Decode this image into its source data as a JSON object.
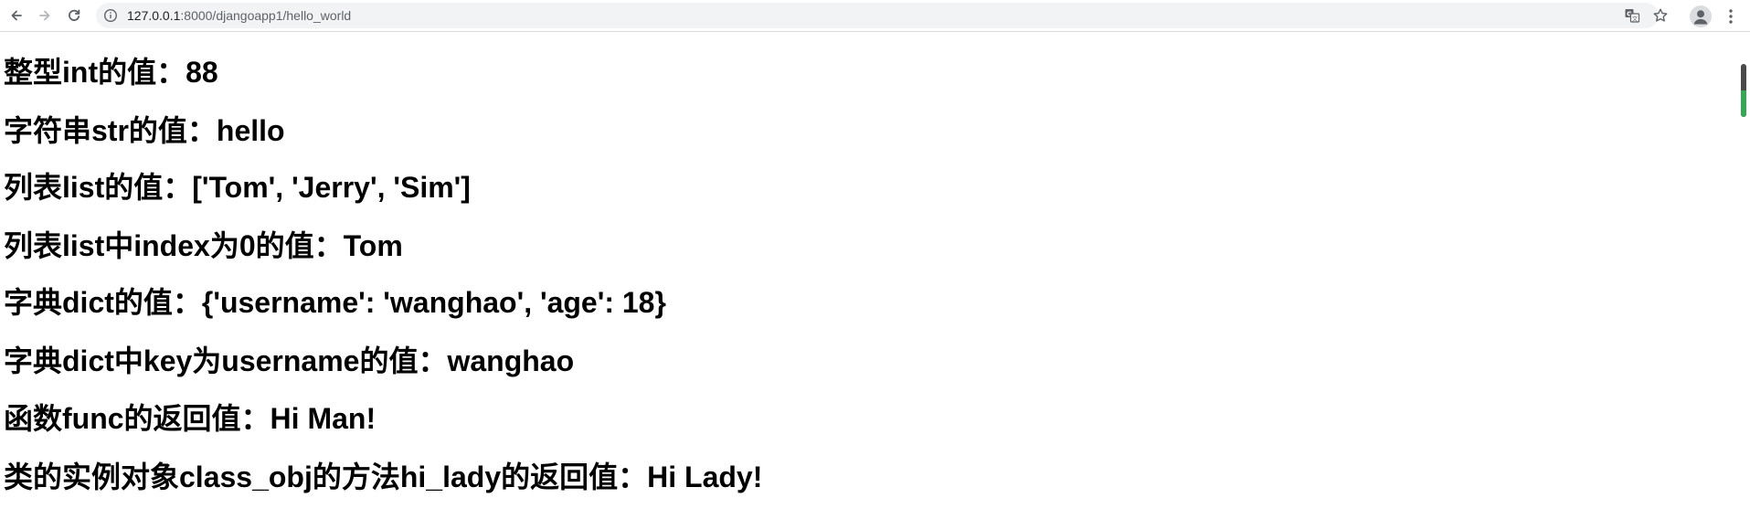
{
  "browser": {
    "url_host": "127.0.0.1",
    "url_rest": ":8000/djangoapp1/hello_world",
    "icons": {
      "back": "arrow-left-icon",
      "forward": "arrow-right-icon",
      "reload": "reload-icon",
      "site_info": "info-icon",
      "translate": "translate-icon",
      "bookmark": "star-icon",
      "profile": "profile-icon",
      "menu": "more-vert-icon"
    },
    "accent_color": "#34a853"
  },
  "page": {
    "lines": [
      "整型int的值：88",
      "字符串str的值：hello",
      "列表list的值：['Tom', 'Jerry', 'Sim']",
      "列表list中index为0的值：Tom",
      "字典dict的值：{'username': 'wanghao', 'age': 18}",
      "字典dict中key为username的值：wanghao",
      "函数func的返回值：Hi Man!",
      "类的实例对象class_obj的方法hi_lady的返回值：Hi Lady!"
    ]
  }
}
